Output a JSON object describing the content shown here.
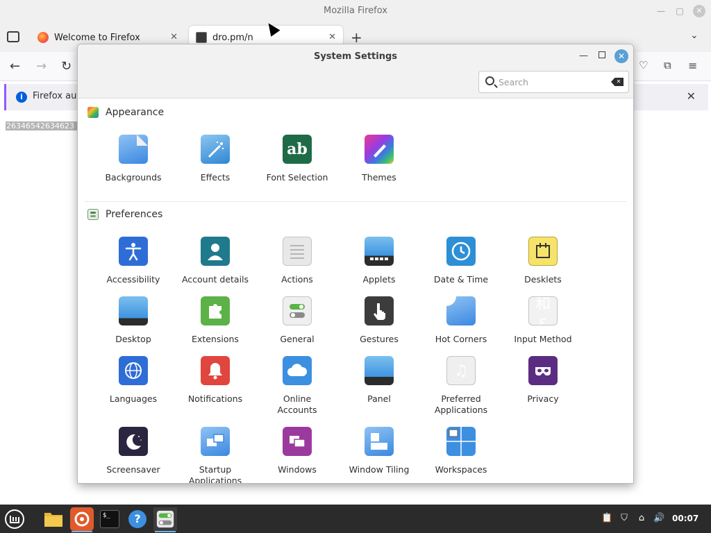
{
  "firefox": {
    "window_title": "Mozilla Firefox",
    "tabs": [
      {
        "label": "Welcome to Firefox"
      },
      {
        "label": "dro.pm/n"
      }
    ],
    "notification_text": "Firefox aut",
    "page_text": "26346542634623"
  },
  "settings": {
    "title": "System Settings",
    "search": {
      "placeholder": "Search",
      "value": ""
    },
    "sections": {
      "appearance": {
        "title": "Appearance",
        "items": [
          "Backgrounds",
          "Effects",
          "Font Selection",
          "Themes"
        ]
      },
      "preferences": {
        "title": "Preferences",
        "items": [
          "Accessibility",
          "Account details",
          "Actions",
          "Applets",
          "Date & Time",
          "Desklets",
          "Desktop",
          "Extensions",
          "General",
          "Gestures",
          "Hot Corners",
          "Input Method",
          "Languages",
          "Notifications",
          "Online\nAccounts",
          "Panel",
          "Preferred\nApplications",
          "Privacy",
          "Screensaver",
          "Startup\nApplications",
          "Windows",
          "Window Tiling",
          "Workspaces"
        ]
      }
    },
    "font_icon_text": "ab",
    "input_icon_text": "和 ε"
  },
  "taskbar": {
    "clock": "00:07",
    "apps": [
      "menu-icon",
      "files-icon",
      "firefox-icon",
      "terminal-icon",
      "help-icon",
      "settings-icon"
    ]
  },
  "colors": {
    "accent": "#5aa0d6",
    "taskbar_bg": "#2b2b2b",
    "firefox_notification_border": "#9059ff"
  }
}
